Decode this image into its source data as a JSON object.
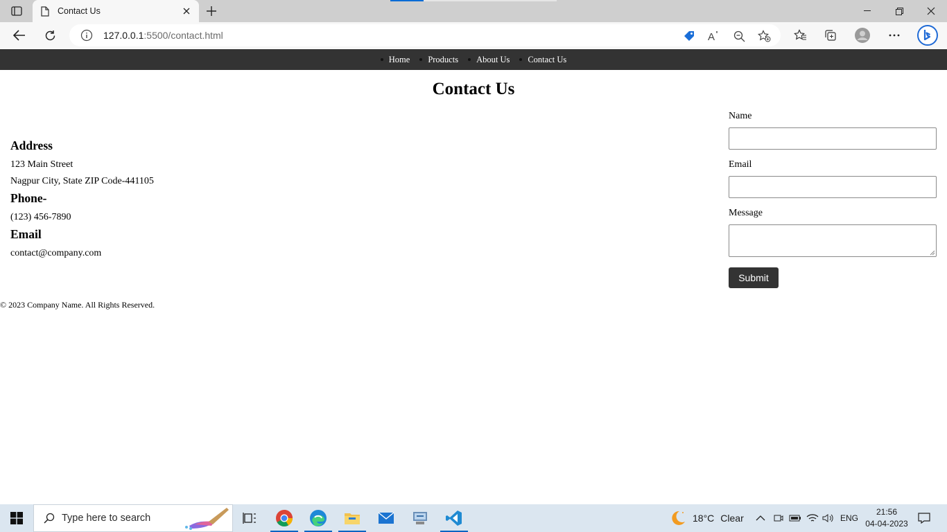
{
  "browser": {
    "tab_title": "Contact Us",
    "url_host": "127.0.0.1",
    "url_rest": ":5500/contact.html"
  },
  "site": {
    "nav": [
      "Home",
      "Products",
      "About Us",
      "Contact Us"
    ],
    "page_title": "Contact Us",
    "address_heading": "Address",
    "address_line1": "123 Main Street",
    "address_line2": "Nagpur City, State ZIP Code-441105",
    "phone_heading": "Phone-",
    "phone_value": "(123) 456-7890",
    "email_heading": "Email",
    "email_value": "contact@company.com",
    "form": {
      "name_label": "Name",
      "email_label": "Email",
      "message_label": "Message",
      "submit_label": "Submit",
      "name_value": "",
      "email_value": "",
      "message_value": ""
    },
    "footer": "© 2023 Company Name. All Rights Reserved."
  },
  "taskbar": {
    "search_placeholder": "Type here to search",
    "weather_temp": "18°C",
    "weather_desc": "Clear",
    "language": "ENG",
    "time": "21:56",
    "date": "04-04-2023"
  },
  "colors": {
    "nav_bg": "#333333",
    "submit_bg": "#333333",
    "accent_blue": "#0a6cd6"
  }
}
